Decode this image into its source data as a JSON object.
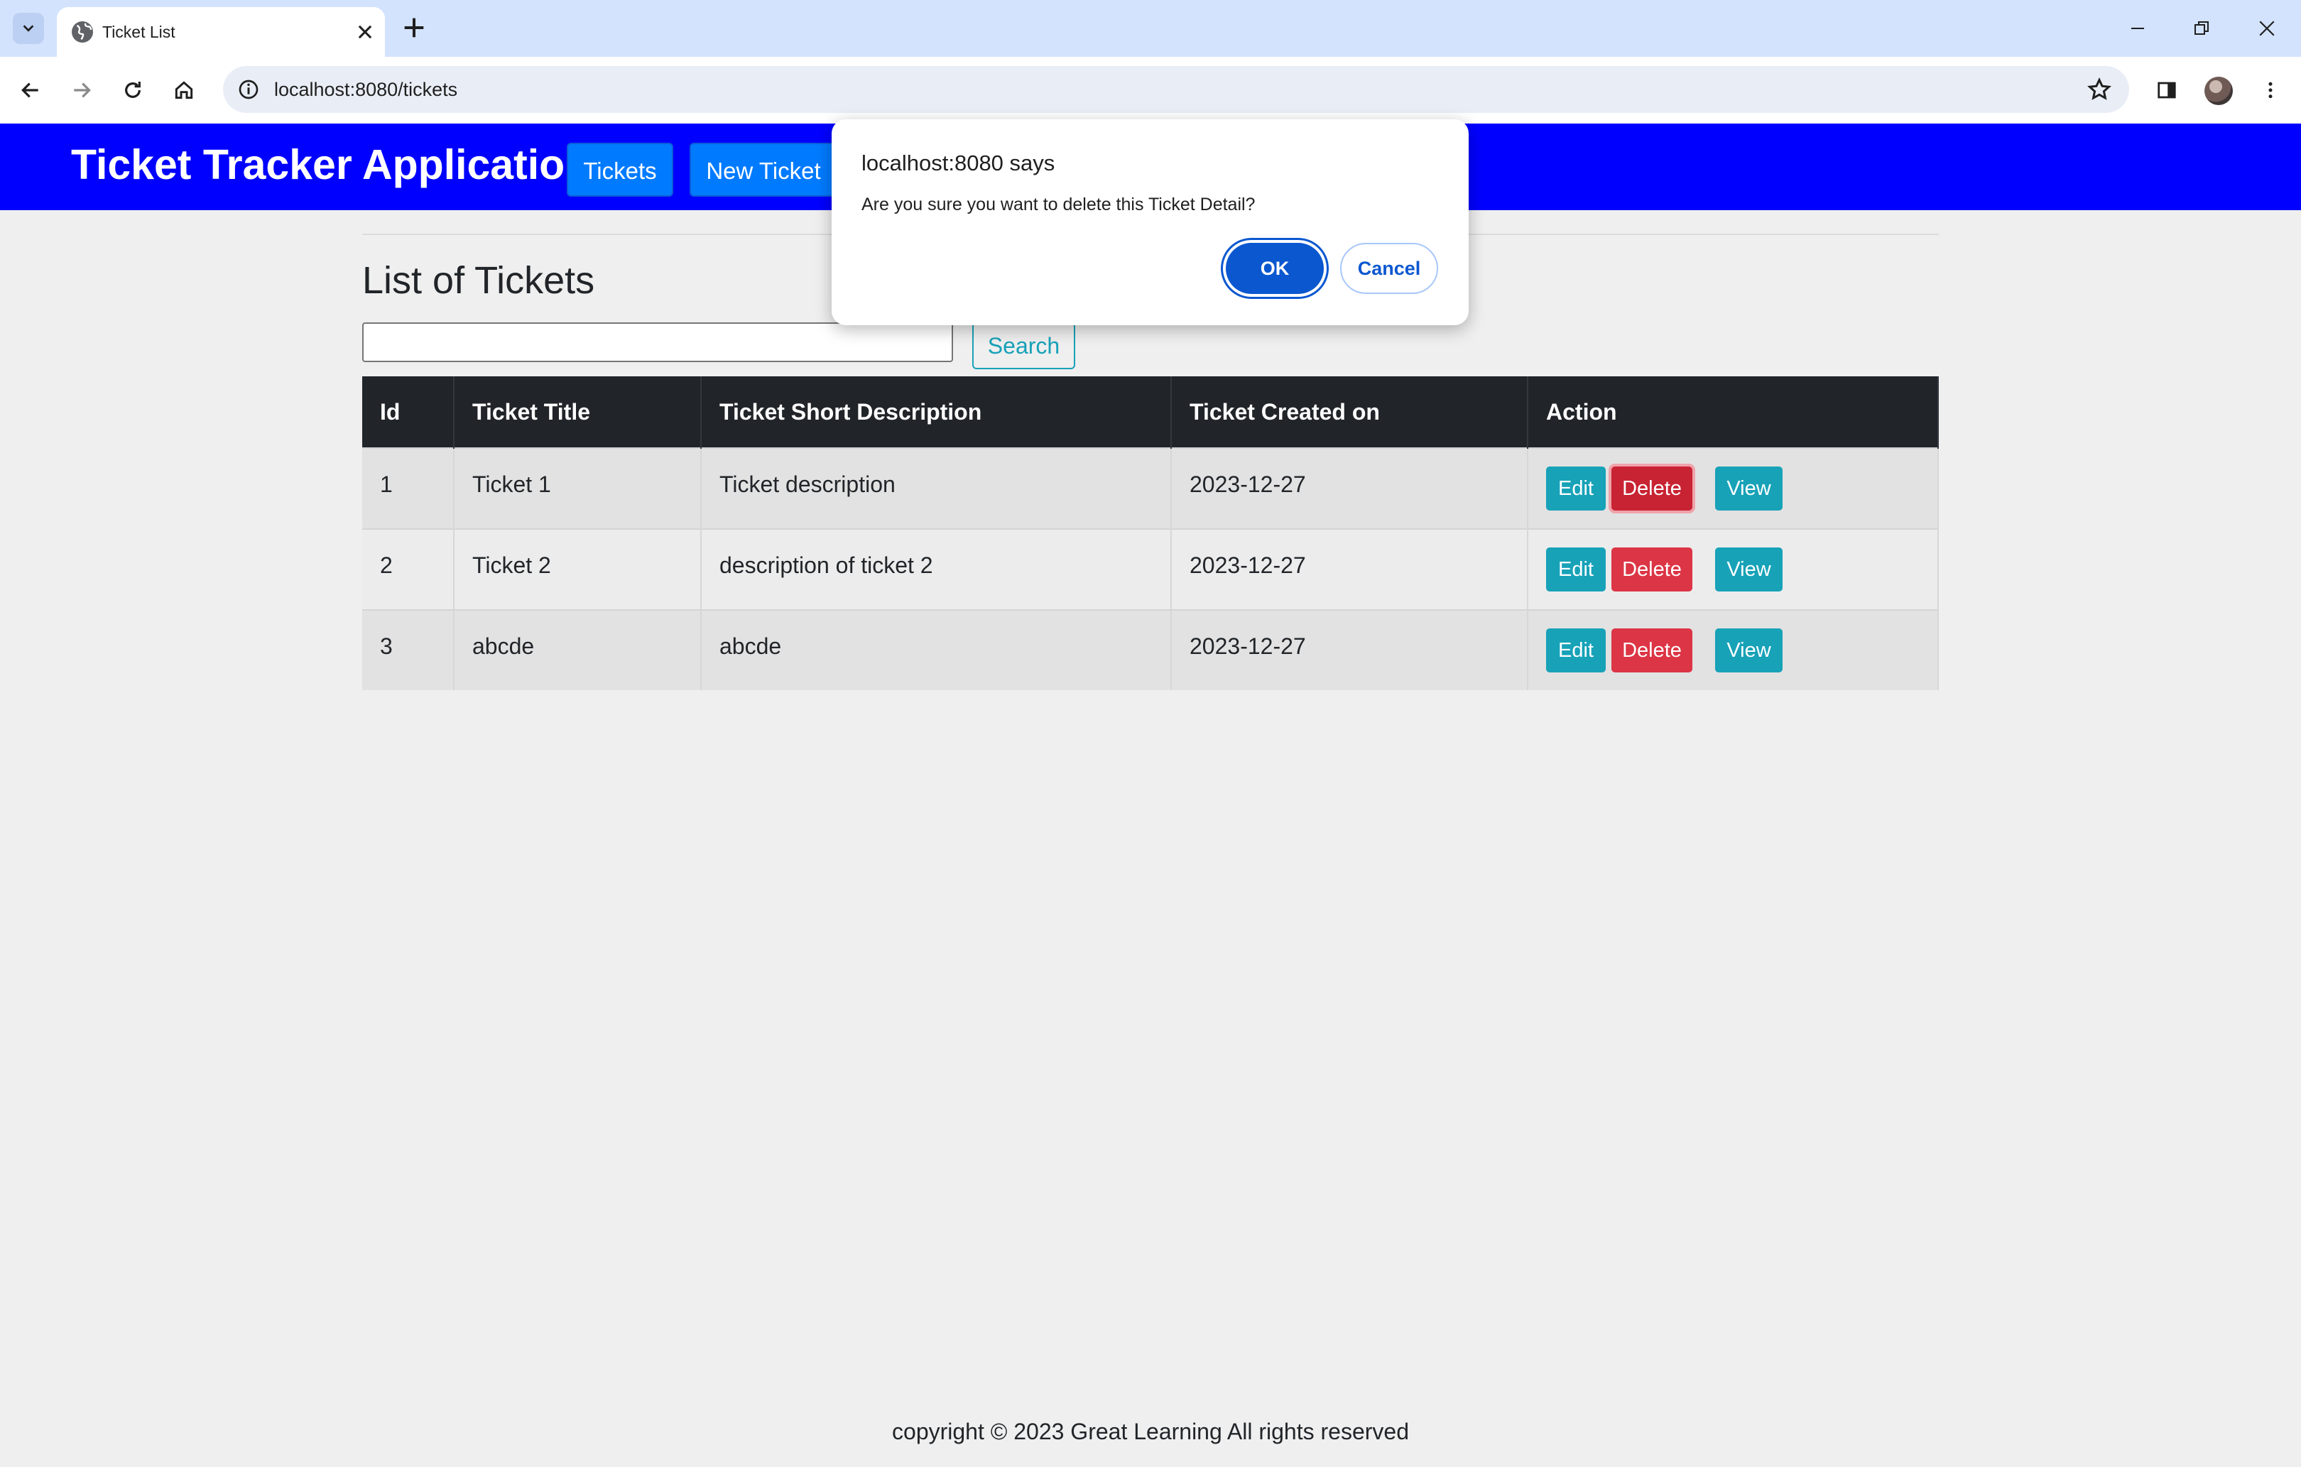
{
  "browser": {
    "tab_title": "Ticket List",
    "url": "localhost:8080/tickets"
  },
  "header": {
    "app_title": "Ticket Tracker Application",
    "nav": [
      {
        "label": "Tickets"
      },
      {
        "label": "New Ticket"
      }
    ]
  },
  "main": {
    "heading": "List of Tickets",
    "search_value": "",
    "search_button": "Search",
    "table": {
      "columns": [
        "Id",
        "Ticket Title",
        "Ticket Short Description",
        "Ticket Created on",
        "Action"
      ],
      "rows": [
        {
          "id": "1",
          "title": "Ticket 1",
          "description": "Ticket description",
          "created": "2023-12-27"
        },
        {
          "id": "2",
          "title": "Ticket 2",
          "description": "description of ticket 2",
          "created": "2023-12-27"
        },
        {
          "id": "3",
          "title": "abcde",
          "description": "abcde",
          "created": "2023-12-27"
        }
      ],
      "actions": {
        "edit": "Edit",
        "delete": "Delete",
        "view": "View"
      }
    }
  },
  "footer": {
    "text": "copyright © 2023 Great Learning All rights reserved"
  },
  "dialog": {
    "title": "localhost:8080 says",
    "message": "Are you sure you want to delete this Ticket Detail?",
    "ok": "OK",
    "cancel": "Cancel"
  },
  "colors": {
    "header_bg": "#0000ff",
    "nav_button": "#007bff",
    "table_header": "#212529",
    "info": "#17a2b8",
    "danger": "#dc3545",
    "dialog_primary": "#0b57d0"
  }
}
